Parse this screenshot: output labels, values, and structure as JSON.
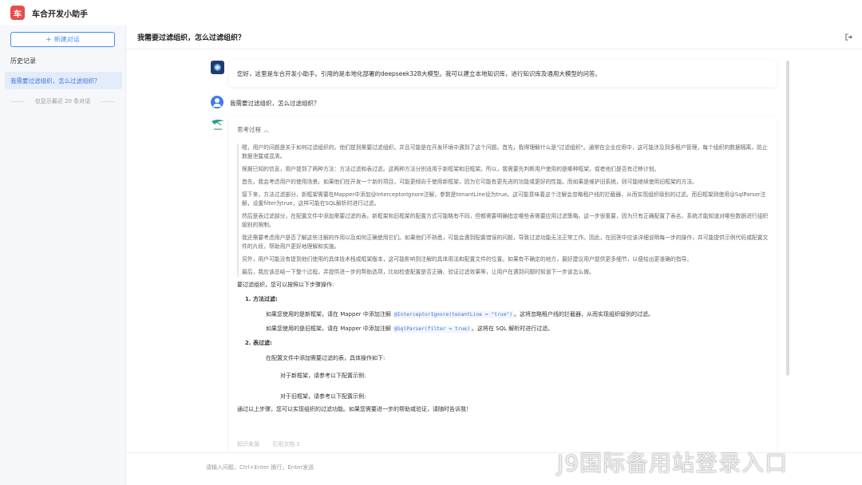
{
  "app": {
    "logo_char": "车",
    "title": "车合开发小助手",
    "logo_color": "#e94c4c"
  },
  "sidebar": {
    "new_chat_label": "新建对话",
    "history_title": "历史记录",
    "history_items": [
      {
        "label": "我需要过滤组织，怎么过滤组织？"
      }
    ],
    "history_note": "仅显示最近 20 条对话"
  },
  "header": {
    "title": "我需要过滤组织，怎么过滤组织？"
  },
  "messages": {
    "greeting": "您好，这里是车合开发小助手。引用的是本地化部署的deepseek32B大模型。我可以建立本地知识库，进行知识库及通用大模型的问答。",
    "user_question": "我需要过滤组织，怎么过滤组织？",
    "think_label": "思考过程",
    "think_paragraphs": [
      "嗯，用户的问题是关于如何过滤组织的。他们提到需要过滤组织，并且可能是在开发环境中遇到了这个问题。首先，我得理解什么是\"过滤组织\"。通常在企业应用中，这可能涉及到多租户管理，每个组织的数据隔离，防止数据泄露或混淆。",
      "根据已知的信息，用户提到了两种方法：方法过滤和表过滤。这两种方法分别适用于新框架和旧框架。所以，我需要先判断用户使用的是哪种框架，或者他们是否有迁移计划。",
      "首先，我会考虑用户的使用场景。如果他们在开发一个新的项目，可能更倾向于使用新框架，因为它可能有更先进的功能或更好的性能。而如果是维护旧系统，则可能继续使用旧框架的方法。",
      "接下来，方法过滤部分，新框架需要在Mapper中添加@InterceptorIgnore注解，参数是tenantLine设为true。这可能意味着这个注解会忽略租户线的拦截器，从而实现组织级别的过滤。而旧框架则使用@SqlParser注解，设置filter为true，这样可能在SQL解析时进行过滤。",
      "然后是表过滤部分，在配置文件中添加需要过滤的表。新框架和旧框架的配置方式可能略有不同，但都需要明确指定哪些表需要应用过滤策略。这一步很重要，因为只有正确配置了表名，系统才能知道对哪些数据进行组织级别的限制。",
      "我还需要考虑用户是否了解这些注解的作用以及如何正确使用它们。如果他们不熟悉，可能会遇到配置错误的问题，导致过滤功能无法正常工作。因此，在回答中应该详细说明每一步的操作，并可能提供示例代码或配置文件的片段，帮助用户更好地理解和实施。",
      "另外，用户可能没有提到他们使用的具体技术栈或框架版本，这可能影响到注解的具体用法和配置文件的位置。如果有不确定的地方，最好建议用户提供更多细节，以便给出更准确的指导。",
      "最后，我应该总结一下整个过程，并提供进一步的帮助选项，比如检查配置是否正确、验证过滤效果等，让用户在遇到问题时知道下一步该怎么做。"
    ],
    "answer_intro": "要过滤组织，您可以按照以下步骤操作:",
    "step1_title": "1. 方法过滤:",
    "step1_new_pre": "如果您使用的是新框架，请在 Mapper 中添加注解",
    "step1_new_code": "@InterceptorIgnore(tenantLine = \"true\")",
    "step1_new_post": "。这将忽略租户线的拦截器，从而实现组织级别的过滤。",
    "step1_old_pre": "如果您使用的是旧框架，请在 Mapper 中添加注解",
    "step1_old_code": "@SqlParser(filter = true)",
    "step1_old_post": "。这将在 SQL 解析时进行过滤。",
    "step2_title": "2. 表过滤:",
    "step2_desc": "在配置文件中添加需要过滤的表，具体操作如下:",
    "step2_new": "对于新框架，请参考以下配置示例:",
    "step2_old": "对于旧框架，请参考以下配置示例:",
    "conclusion": "通过以上步骤，您可以实现组织的过滤功能。如果您需要进一步的帮助或验证，请随时告诉我！",
    "actions": [
      "知识来源",
      "引用文档 1"
    ]
  },
  "input": {
    "placeholder": "请输入问题，Ctrl+Enter 换行，Enter发送"
  },
  "watermark": "J9国际备用站登录入口"
}
